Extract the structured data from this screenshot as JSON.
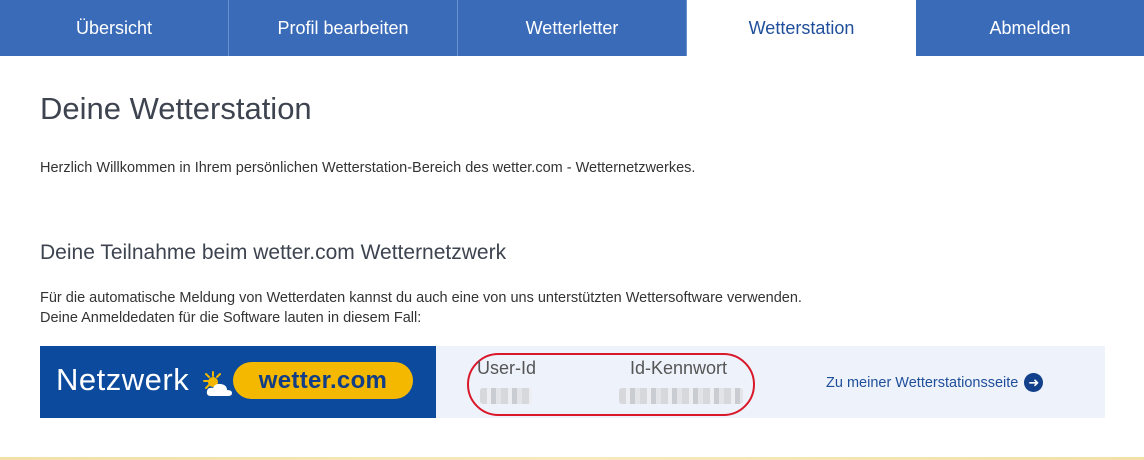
{
  "nav": {
    "tabs": [
      {
        "label": "Übersicht"
      },
      {
        "label": "Profil bearbeiten"
      },
      {
        "label": "Wetterletter"
      },
      {
        "label": "Wetterstation",
        "active": true
      },
      {
        "label": "Abmelden"
      }
    ]
  },
  "main": {
    "title": "Deine Wetterstation",
    "intro": "Herzlich Willkommen in Ihrem persönlichen Wetterstation-Bereich des wetter.com - Wetternetzwerkes.",
    "section_title": "Deine Teilnahme beim wetter.com Wetternetzwerk",
    "desc_line1": "Für die automatische Meldung von Wetterdaten kannst du auch eine von uns unterstützten Wettersoftware verwenden.",
    "desc_line2": "Deine Anmeldedaten für die Software lauten in diesem Fall:"
  },
  "banner": {
    "brand_word": "Netzwerk",
    "brand_pill": "wetter.com",
    "user_id_label": "User-Id",
    "password_label": "Id-Kennwort",
    "station_link": "Zu meiner Wetterstationsseite"
  },
  "colors": {
    "nav_bg": "#3a6bb8",
    "active_tab_text": "#1f4e9a",
    "brand_blue": "#0b4a9d",
    "brand_yellow": "#f5b800",
    "highlight_red": "#d9182a"
  },
  "icons": {
    "weather": "sun-cloud-icon",
    "link_arrow": "arrow-right-circle-icon"
  }
}
